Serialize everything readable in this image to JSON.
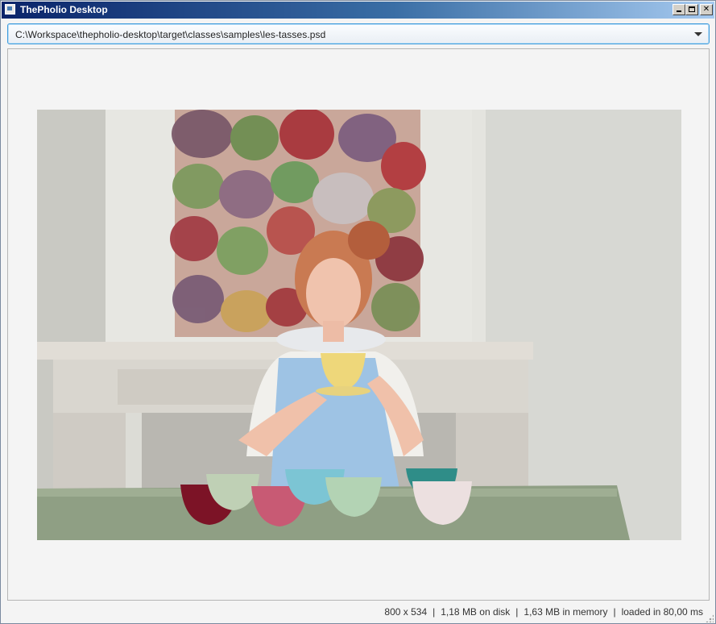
{
  "window": {
    "title": "ThePholio Desktop",
    "icon": "app-window-icon",
    "controls": [
      "minimize-icon",
      "maximize-icon",
      "close-icon"
    ],
    "close_glyph": "✕"
  },
  "path_bar": {
    "value": "C:\\Workspace\\thepholio-desktop\\target\\classes\\samples\\les-tasses.psd",
    "icon": "chevron-down-icon",
    "accent": "#3d9bdc"
  },
  "image": {
    "description_icon": "photo",
    "dimensions": "800 x 534"
  },
  "status": {
    "dimensions": "800 x 534",
    "disk_size": "1,18 MB on disk",
    "memory_size": "1,63 MB in memory",
    "load_time": "loaded in 80,00 ms",
    "separator": "|"
  }
}
